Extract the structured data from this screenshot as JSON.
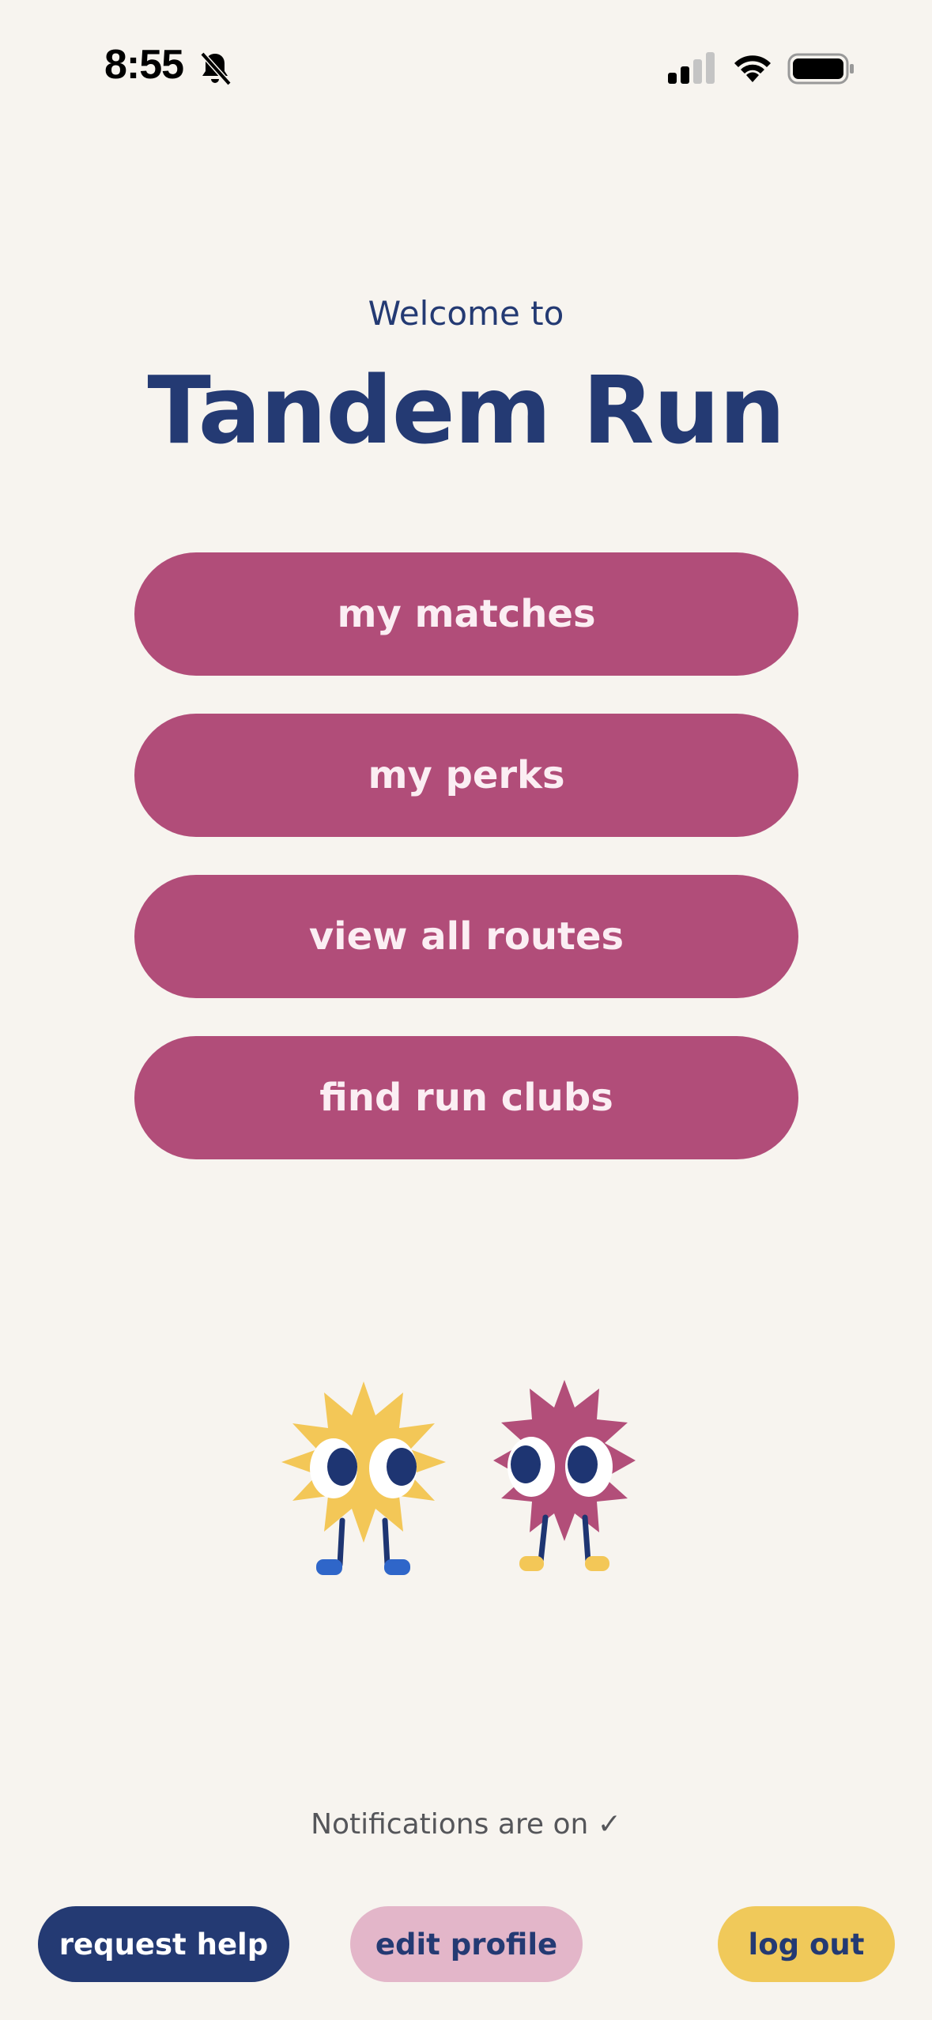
{
  "status_bar": {
    "time": "8:55",
    "icons": [
      "bell-slash-icon",
      "cellular-signal-icon",
      "wifi-icon",
      "battery-icon"
    ]
  },
  "header": {
    "welcome": "Welcome to",
    "title": "Tandem Run"
  },
  "menu": {
    "items": [
      {
        "label": "my matches"
      },
      {
        "label": "my perks"
      },
      {
        "label": "view all routes"
      },
      {
        "label": "find run clubs"
      }
    ]
  },
  "notifications": {
    "status": "Notifications are on ✓"
  },
  "footer": {
    "request_help": "request help",
    "edit_profile": "edit profile",
    "log_out": "log out"
  },
  "colors": {
    "background": "#f7f4ef",
    "navy": "#243a73",
    "pink": "#b14d79",
    "light_pink": "#e3b6c9",
    "yellow": "#f0c95a"
  }
}
